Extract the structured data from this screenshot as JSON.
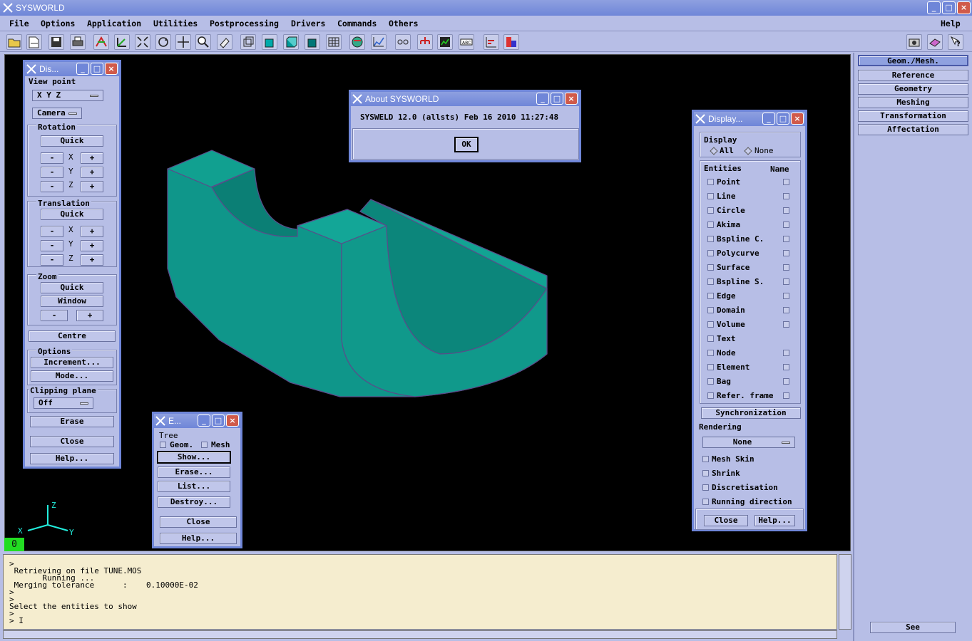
{
  "app": {
    "title": "SYSWORLD"
  },
  "menu": {
    "items": [
      "File",
      "Options",
      "Application",
      "Utilities",
      "Postprocessing",
      "Drivers",
      "Commands",
      "Others"
    ],
    "help": "Help"
  },
  "window_buttons": {
    "minimize": "_",
    "maximize": "□",
    "close": "×"
  },
  "right_panel": {
    "buttons": [
      "Geom./Mesh.",
      "Reference",
      "Geometry",
      "Meshing",
      "Transformation",
      "Affectation"
    ],
    "see": "See"
  },
  "display_panel": {
    "title": "Dis...",
    "view_point": "View point",
    "xyz": "X  Y  Z",
    "camera": "Camera",
    "rotation": "Rotation",
    "quick": "Quick",
    "minus": "-",
    "plus": "+",
    "x": "X",
    "y": "Y",
    "z": "Z",
    "translation": "Translation",
    "zoom": "Zoom",
    "window": "Window",
    "centre": "Centre",
    "options": "Options",
    "increment": "Increment...",
    "mode": "Mode...",
    "clipping_plane": "Clipping plane",
    "off": "Off",
    "erase": "Erase",
    "close": "Close",
    "help": "Help..."
  },
  "about_dialog": {
    "title": "About SYSWORLD",
    "version": "SYSWELD 12.0 (allsts) Feb 16 2010 11:27:48",
    "ok": "OK"
  },
  "entities_panel": {
    "title": "E...",
    "tree": "Tree",
    "geom": "Geom.",
    "mesh": "Mesh",
    "show": "Show...",
    "erase": "Erase...",
    "list": "List...",
    "destroy": "Destroy...",
    "close": "Close",
    "help": "Help..."
  },
  "display2_panel": {
    "title": "Display...",
    "display": "Display",
    "all": "All",
    "none": "None",
    "entities": "Entities",
    "name": "Name",
    "rows": [
      {
        "label": "Point",
        "name_box": true
      },
      {
        "label": "Line",
        "name_box": true
      },
      {
        "label": "Circle",
        "name_box": true
      },
      {
        "label": "Akima",
        "name_box": true
      },
      {
        "label": "Bspline C.",
        "name_box": true
      },
      {
        "label": "Polycurve",
        "name_box": true
      },
      {
        "label": "Surface",
        "name_box": true
      },
      {
        "label": "Bspline S.",
        "name_box": true
      },
      {
        "label": "Edge",
        "name_box": true
      },
      {
        "label": "Domain",
        "name_box": true
      },
      {
        "label": "Volume",
        "name_box": true
      },
      {
        "label": "Text",
        "name_box": false
      },
      {
        "label": "Node",
        "name_box": true
      },
      {
        "label": "Element",
        "name_box": true
      },
      {
        "label": "Bag",
        "name_box": true
      },
      {
        "label": "Refer. frame",
        "name_box": true
      }
    ],
    "synchronization": "Synchronization",
    "rendering": "Rendering",
    "rendering_value": "None",
    "options": [
      "Mesh Skin",
      "Shrink",
      "Discretisation",
      "Running direction"
    ],
    "close": "Close",
    "help": "Help..."
  },
  "viewport": {
    "axis_x": "X",
    "axis_y": "Y",
    "axis_z": "Z",
    "counter": "0"
  },
  "console": {
    "lines": [
      ">",
      " Retrieving on file TUNE.MOS",
      "       Running ...",
      " Merging tolerance      :    0.10000E-02",
      ">",
      ">",
      "Select the entities to show",
      ">",
      "> I"
    ]
  },
  "colors": {
    "model": "#0f9a8e",
    "model_dark": "#0b7f75",
    "model_light": "#14a89a",
    "edge": "#6a5a9a"
  },
  "toolbar_icons": [
    "open-folder-icon",
    "open-file-icon",
    "save-icon",
    "print-icon",
    "transform-icon",
    "axes-icon",
    "fit-icon",
    "rotate-icon",
    "pan-icon",
    "zoom-icon",
    "erase-icon",
    "box-wire-icon",
    "box-solid-icon",
    "box-shade-icon",
    "box-hidden-icon",
    "box-grid-icon",
    "globe-icon",
    "graph-icon",
    "path-icon",
    "tree-icon",
    "chip-icon",
    "abc-icon",
    "chart-icon",
    "color-map-icon",
    "camera-icon",
    "book-icon",
    "help-icon"
  ]
}
